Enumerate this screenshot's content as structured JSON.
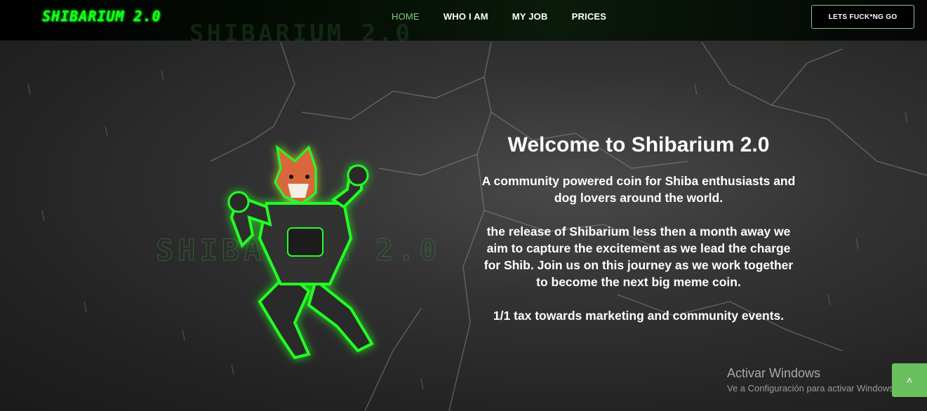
{
  "header": {
    "brand": "SHIBARIUM 2.0",
    "nav": [
      {
        "label": "HOME",
        "active": true
      },
      {
        "label": "WHO I AM"
      },
      {
        "label": "MY JOB"
      },
      {
        "label": "PRICES"
      }
    ],
    "cta_label": "LETS FUCK*NG GO"
  },
  "hero": {
    "watermark": "SHIBARIUM 2.0",
    "title": "Welcome to Shibarium 2.0",
    "paragraphs": [
      "A community powered coin for Shiba enthusiasts and dog lovers around the world.",
      "the release of Shibarium less then a month away we aim to capture the excitement as we lead the charge for Shib. Join us on this journey as we work together to become the next big meme coin.",
      "1/1 tax towards marketing and community events."
    ],
    "mascot_icon": "shiba-robot-mascot"
  },
  "windows_notice": {
    "title": "Activar Windows",
    "subtitle": "Ve a Configuración para activar Windows."
  },
  "scroll_top_icon": "chevron-up-icon",
  "colors": {
    "brand_green": "#1aff1a",
    "nav_active": "#7ecf7e",
    "scroll_button": "#6abf5e"
  }
}
